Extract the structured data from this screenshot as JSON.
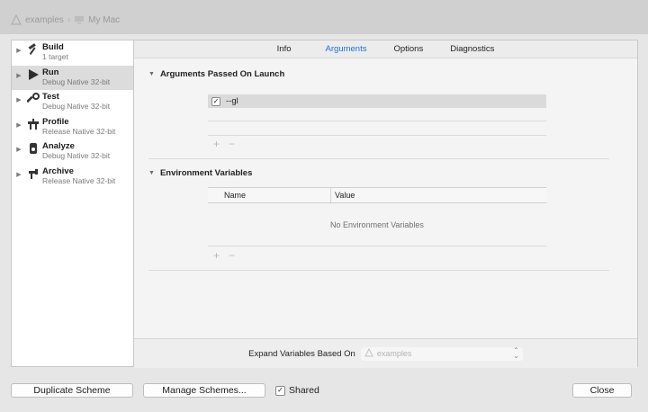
{
  "breadcrumb": {
    "project": "examples",
    "destination": "My Mac"
  },
  "sidebar": {
    "actions": [
      {
        "name": "Build",
        "sub": "1 target",
        "icon": "hammer-icon",
        "selected": false
      },
      {
        "name": "Run",
        "sub": "Debug Native 32-bit",
        "icon": "play-icon",
        "selected": true
      },
      {
        "name": "Test",
        "sub": "Debug Native 32-bit",
        "icon": "wrench-icon",
        "selected": false
      },
      {
        "name": "Profile",
        "sub": "Release Native 32-bit",
        "icon": "gauge-tool-icon",
        "selected": false
      },
      {
        "name": "Analyze",
        "sub": "Debug Native 32-bit",
        "icon": "analyze-icon",
        "selected": false
      },
      {
        "name": "Archive",
        "sub": "Release Native 32-bit",
        "icon": "archive-icon",
        "selected": false
      }
    ]
  },
  "tabs": [
    {
      "label": "Info",
      "active": false
    },
    {
      "label": "Arguments",
      "active": true
    },
    {
      "label": "Options",
      "active": false
    },
    {
      "label": "Diagnostics",
      "active": false
    }
  ],
  "arguments": {
    "header": "Arguments Passed On Launch",
    "items": [
      {
        "checked": true,
        "checkmark": "✓",
        "value": "--gl"
      }
    ],
    "add_label": "+",
    "remove_label": "−"
  },
  "environment": {
    "header": "Environment Variables",
    "columns": {
      "name": "Name",
      "value": "Value"
    },
    "empty_text": "No Environment Variables",
    "add_label": "+",
    "remove_label": "−"
  },
  "expand": {
    "label": "Expand Variables Based On",
    "selected": "examples"
  },
  "footer": {
    "duplicate": "Duplicate Scheme",
    "manage": "Manage Schemes...",
    "shared_label": "Shared",
    "shared_checked": true,
    "shared_checkmark": "✓",
    "close": "Close"
  },
  "colors": {
    "accent": "#1e6fd9",
    "selected_row": "#dcdcdc"
  }
}
